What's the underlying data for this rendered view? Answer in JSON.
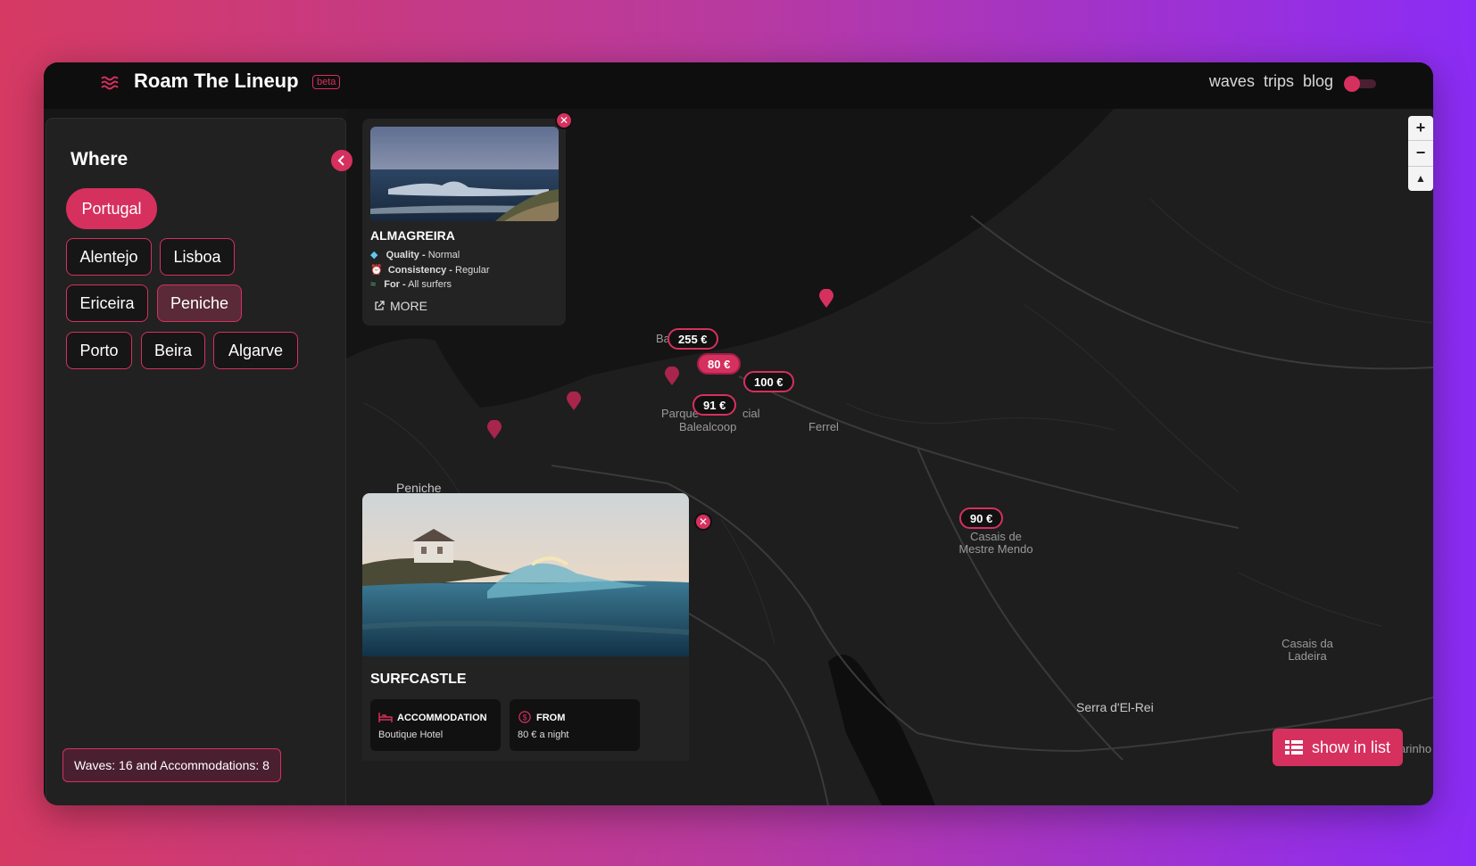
{
  "header": {
    "title": "Roam The Lineup",
    "badge": "beta",
    "nav": [
      "waves",
      "trips",
      "blog"
    ]
  },
  "sidebar": {
    "heading": "Where",
    "country": "Portugal",
    "regions": [
      "Alentejo",
      "Lisboa",
      "Ericeira",
      "Peniche",
      "Porto",
      "Beira",
      "Algarve"
    ],
    "selected_region": "Peniche",
    "counts": "Waves: 16 and Accommodations: 8"
  },
  "map": {
    "places": {
      "baleal": "Bal",
      "parque": "Parque",
      "parque_tail": "cial",
      "balealcoop": "Balealcoop",
      "ferrel": "Ferrel",
      "peniche": "Peniche",
      "casais_mestre_1": "Casais de",
      "casais_mestre_2": "Mestre Mendo",
      "casais_ladeira_1": "Casais da",
      "casais_ladeira_2": "Ladeira",
      "serra": "Serra d'El-Rei",
      "carinho": "arinho"
    },
    "prices": [
      "255 €",
      "80 €",
      "100 €",
      "91 €",
      "90 €"
    ],
    "selected_price": "80 €"
  },
  "wave_card": {
    "title": "ALMAGREIRA",
    "attributes": [
      {
        "label": "Quality -",
        "value": "Normal",
        "icon": "gem-icon"
      },
      {
        "label": "Consistency -",
        "value": "Regular",
        "icon": "alarm-clock-icon"
      },
      {
        "label": "For -",
        "value": "All surfers",
        "icon": "surfer-icon"
      }
    ],
    "more": "MORE"
  },
  "accommodation_card": {
    "title": "SURFCASTLE",
    "type_label": "ACCOMMODATION",
    "type_value": "Boutique Hotel",
    "price_label": "FROM",
    "price_value": "80 € a night"
  },
  "show_in_list": "show in list",
  "colors": {
    "accent": "#d6305f",
    "background": "#161616"
  }
}
